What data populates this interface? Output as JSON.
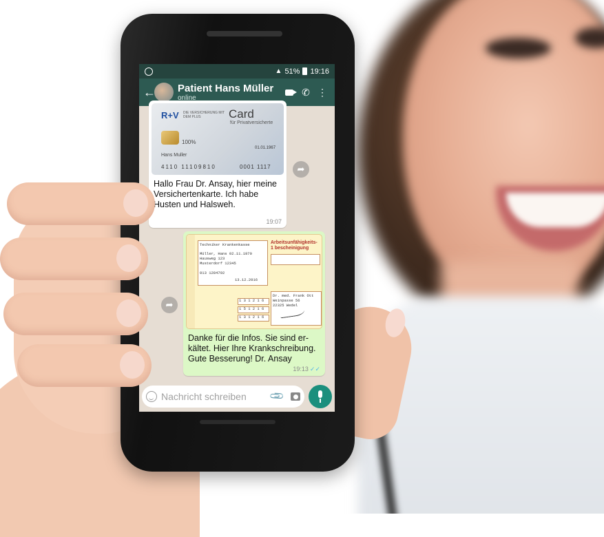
{
  "status_bar": {
    "battery": "51%",
    "time": "19:16"
  },
  "chat_header": {
    "title": "Patient Hans Müller",
    "status": "online"
  },
  "messages": [
    {
      "direction": "incoming",
      "image": {
        "logo": "R+V",
        "logo_sub": "DIE VERSICHERUNG MIT DEM PLUS",
        "heading": "Card",
        "subheading": "für Privatversicherte",
        "percent": "100%",
        "name": "Hans Muller",
        "number": "4110   11109810",
        "number2": "0001   1117",
        "date": "01.01.1967"
      },
      "text": "Hallo Frau Dr. Ansay, hier meine Versichertenkarte. Ich habe Husten und Halsweh.",
      "time": "19:07"
    },
    {
      "direction": "outgoing",
      "image": {
        "insurer": "Techniker Krankenkasse",
        "patient_lines": [
          "Müller, Hans        02.11.1970",
          "Hausweg 123",
          "Musterdorf 12345"
        ],
        "ids": [
          "013   1284792",
          "13.12.2016"
        ],
        "title": "Arbeitsunfähigkeits- 1 bescheinigung",
        "doctor_lines": [
          "Dr. med. Frank Ott",
          "Weinpasse 56",
          "22325 Wedel"
        ],
        "dates": [
          "1 3 1 2 1 6",
          "1 5 1 2 1 6",
          "1 3 1 2 1 6"
        ]
      },
      "text": "Danke für die Infos. Sie sind er-kältet. Hier Ihre Krankschreibung. Gute Besserung! Dr. Ansay",
      "time": "19:13",
      "read_ticks": "✓✓"
    }
  ],
  "composer": {
    "placeholder": "Nachricht schreiben"
  },
  "icons": {
    "back": "←",
    "call": "✆",
    "menu": "⋮",
    "share": "➦",
    "clip": "📎"
  },
  "colors": {
    "header": "#2d5a52",
    "status_bar": "#25443e",
    "outgoing_bubble": "#dcf8c6",
    "chat_background": "#e6ddd3",
    "mic_button": "#1b8f7d"
  }
}
